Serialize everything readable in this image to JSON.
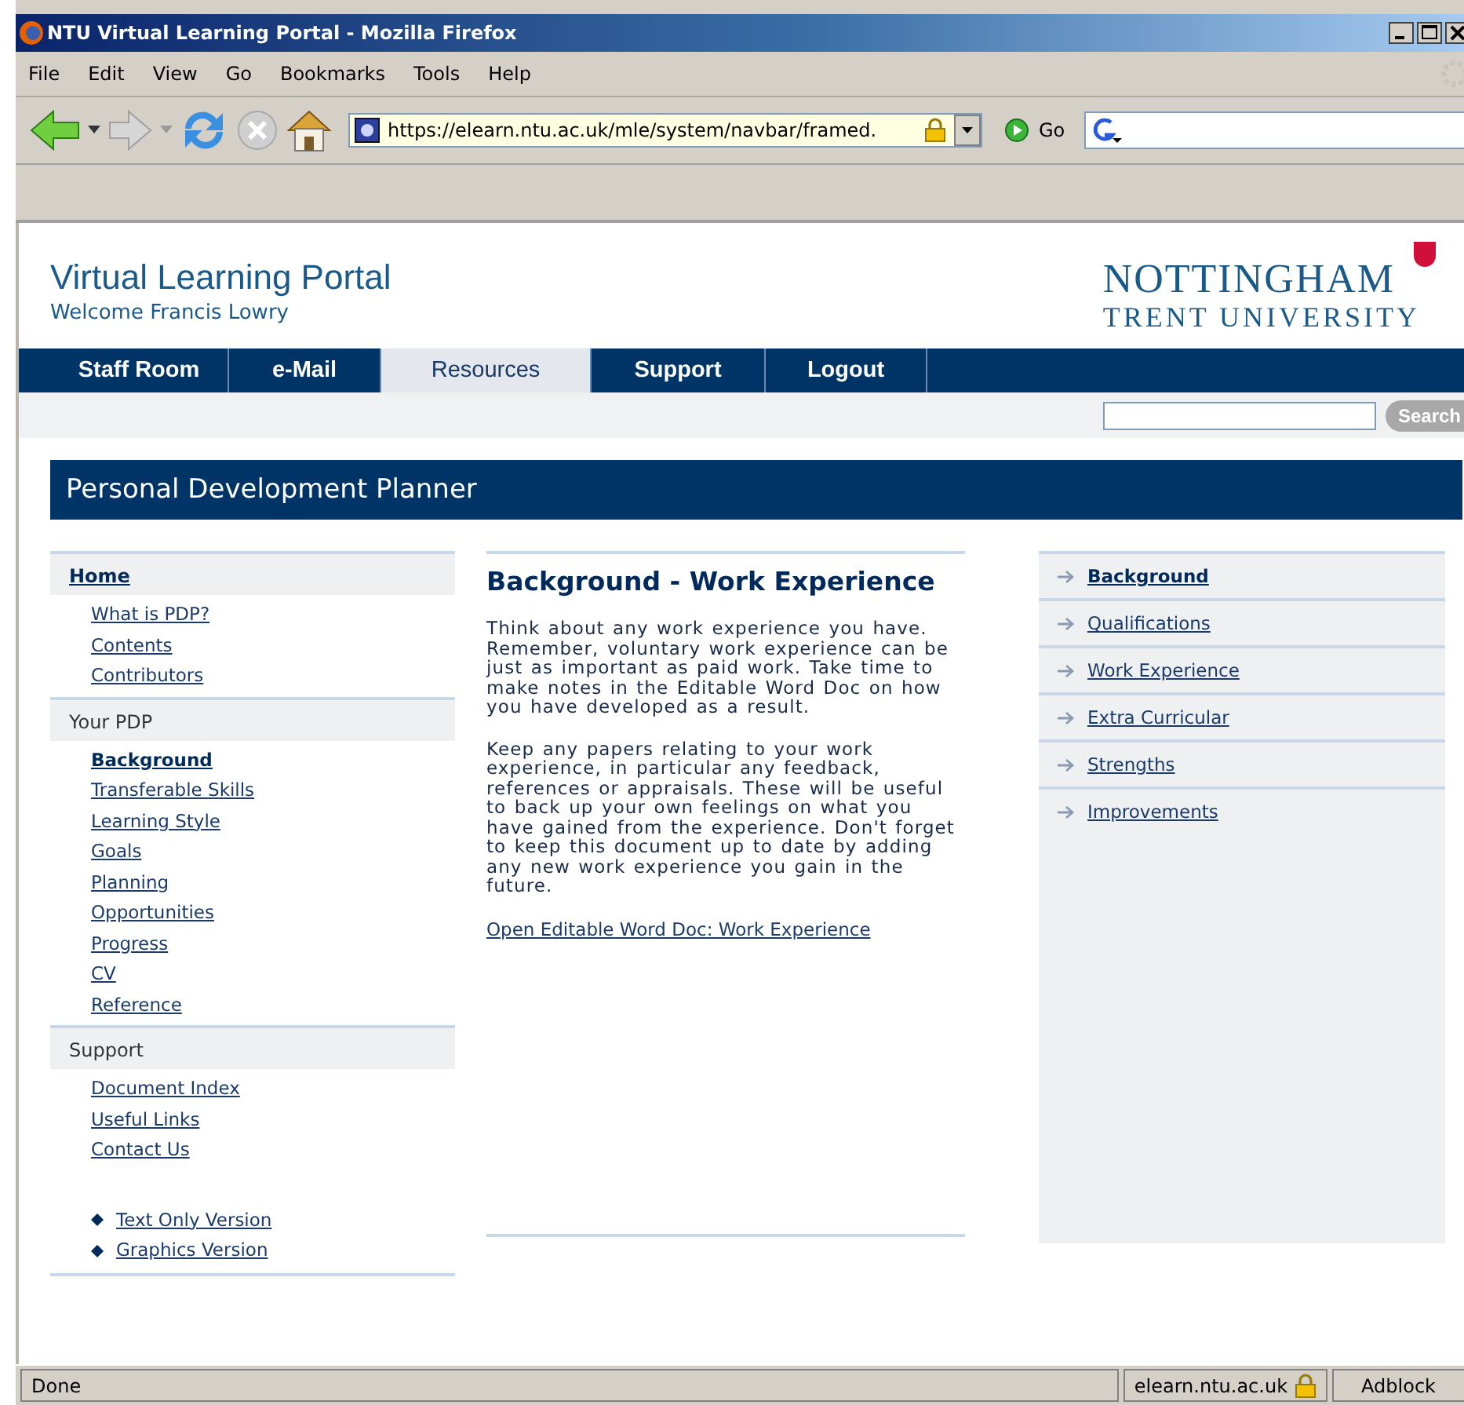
{
  "window": {
    "title": "NTU Virtual Learning Portal - Mozilla Firefox"
  },
  "menu": [
    "File",
    "Edit",
    "View",
    "Go",
    "Bookmarks",
    "Tools",
    "Help"
  ],
  "toolbar": {
    "url": "https://elearn.ntu.ac.uk/mle/system/navbar/framed.",
    "go": "Go"
  },
  "header": {
    "title": "Virtual Learning Portal",
    "welcome": "Welcome Francis Lowry",
    "logo_top": "NOTTINGHAM",
    "logo_bottom": "TRENT UNIVERSITY"
  },
  "tabs": [
    {
      "label": "Staff Room",
      "selected": false
    },
    {
      "label": "e-Mail",
      "selected": false
    },
    {
      "label": "Resources",
      "selected": true
    },
    {
      "label": "Support",
      "selected": false
    },
    {
      "label": "Logout",
      "selected": false
    }
  ],
  "search": {
    "button": "Search"
  },
  "banner": "Personal Development Planner",
  "left_nav": [
    {
      "heading": "Home",
      "link": true,
      "items": [
        {
          "label": "What is PDP?",
          "selected": false
        },
        {
          "label": "Contents",
          "selected": false
        },
        {
          "label": "Contributors",
          "selected": false
        }
      ]
    },
    {
      "heading": "Your PDP",
      "link": false,
      "items": [
        {
          "label": "Background",
          "selected": true
        },
        {
          "label": "Transferable Skills",
          "selected": false
        },
        {
          "label": "Learning Style",
          "selected": false
        },
        {
          "label": "Goals",
          "selected": false
        },
        {
          "label": "Planning",
          "selected": false
        },
        {
          "label": "Opportunities",
          "selected": false
        },
        {
          "label": "Progress",
          "selected": false
        },
        {
          "label": "CV",
          "selected": false
        },
        {
          "label": "Reference",
          "selected": false
        }
      ]
    },
    {
      "heading": "Support",
      "link": false,
      "items": [
        {
          "label": "Document Index",
          "selected": false
        },
        {
          "label": "Useful Links",
          "selected": false
        },
        {
          "label": "Contact Us",
          "selected": false
        }
      ]
    }
  ],
  "versions": [
    "Text Only Version",
    "Graphics Version"
  ],
  "content": {
    "heading": "Background - Work Experience",
    "paragraphs": [
      "Think about any work experience you have. Remember, voluntary work experience can be just as important as paid work. Take time to make notes in the Editable Word Doc on how you have developed as a result.",
      "Keep any papers relating to your work experience, in particular any feedback, references or appraisals. These will be useful to back up your own feelings on what you have gained from the experience. Don't forget to keep this document up to date by adding any new work experience you gain in the future."
    ],
    "link": "Open Editable Word Doc: Work Experience"
  },
  "right_nav": [
    {
      "label": "Background",
      "selected": true
    },
    {
      "label": "Qualifications",
      "selected": false
    },
    {
      "label": "Work Experience",
      "selected": false
    },
    {
      "label": "Extra Curricular",
      "selected": false
    },
    {
      "label": "Strengths",
      "selected": false
    },
    {
      "label": "Improvements",
      "selected": false
    }
  ],
  "status_bar": {
    "text": "Done",
    "host": "elearn.ntu.ac.uk",
    "addon": "Adblock"
  }
}
